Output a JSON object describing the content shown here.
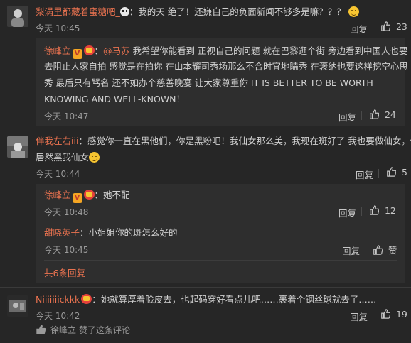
{
  "comments": [
    {
      "user": "梨涡里都藏着蜜糖吧_",
      "separator": "：",
      "text": "我的天 绝了！还嫌自己的负面新闻不够多是嘛？？？",
      "time": "今天 10:45",
      "reply_label": "回复",
      "likes": "23",
      "replies": [
        {
          "user": "徐峰立",
          "mention": "@马苏",
          "text_lines": [
            "我希望你能看到 正视自己的问题 就在巴黎逛个街 旁边看到中国人也要",
            "去阻止人家自拍 感觉是在拍你 在山本耀司秀场那么不合时宜地瞌秀 在褒纳也要这样挖空心思",
            "秀 最后只有骂名 还不如办个慈善晚宴 让大家尊重你  IT IS BETTER TO BE WORTH",
            "KNOWING AND WELL-KNOWN！"
          ],
          "time": "今天 10:47",
          "reply_label": "回复",
          "likes": "24"
        }
      ]
    },
    {
      "user": "伴我左右iii",
      "text_lines": [
        "感觉你一直在黑他们，你是黑粉吧！我仙女那么美，我现在斑好了 我也要做仙女，你",
        "居然黑我仙女"
      ],
      "time": "今天 10:44",
      "reply_label": "回复",
      "likes": "5",
      "replies": [
        {
          "user": "徐峰立",
          "text": "她不配",
          "time": "今天 10:48",
          "reply_label": "回复",
          "likes": "12"
        },
        {
          "user": "甜晓英子",
          "text": "小姐姐你的斑怎么好的",
          "time": "今天 10:45",
          "reply_label": "回复",
          "likes": "赞"
        }
      ],
      "more_replies": "共6条回复"
    },
    {
      "user": "Niiiiiiickkk",
      "text": "她就算厚着脸皮去，也起码穿好看点儿吧……裹着个钢丝球就去了……",
      "time": "今天 10:42",
      "reply_label": "回复",
      "likes": "19",
      "liked_by_user": "徐峰立",
      "liked_by_suffix": "赞了这条评论"
    }
  ],
  "colors": {
    "background": "#262626",
    "reply_background": "#2e2e2e",
    "username": "#eb7350",
    "text": "#d0d0d0",
    "meta": "#9a9a9a"
  }
}
